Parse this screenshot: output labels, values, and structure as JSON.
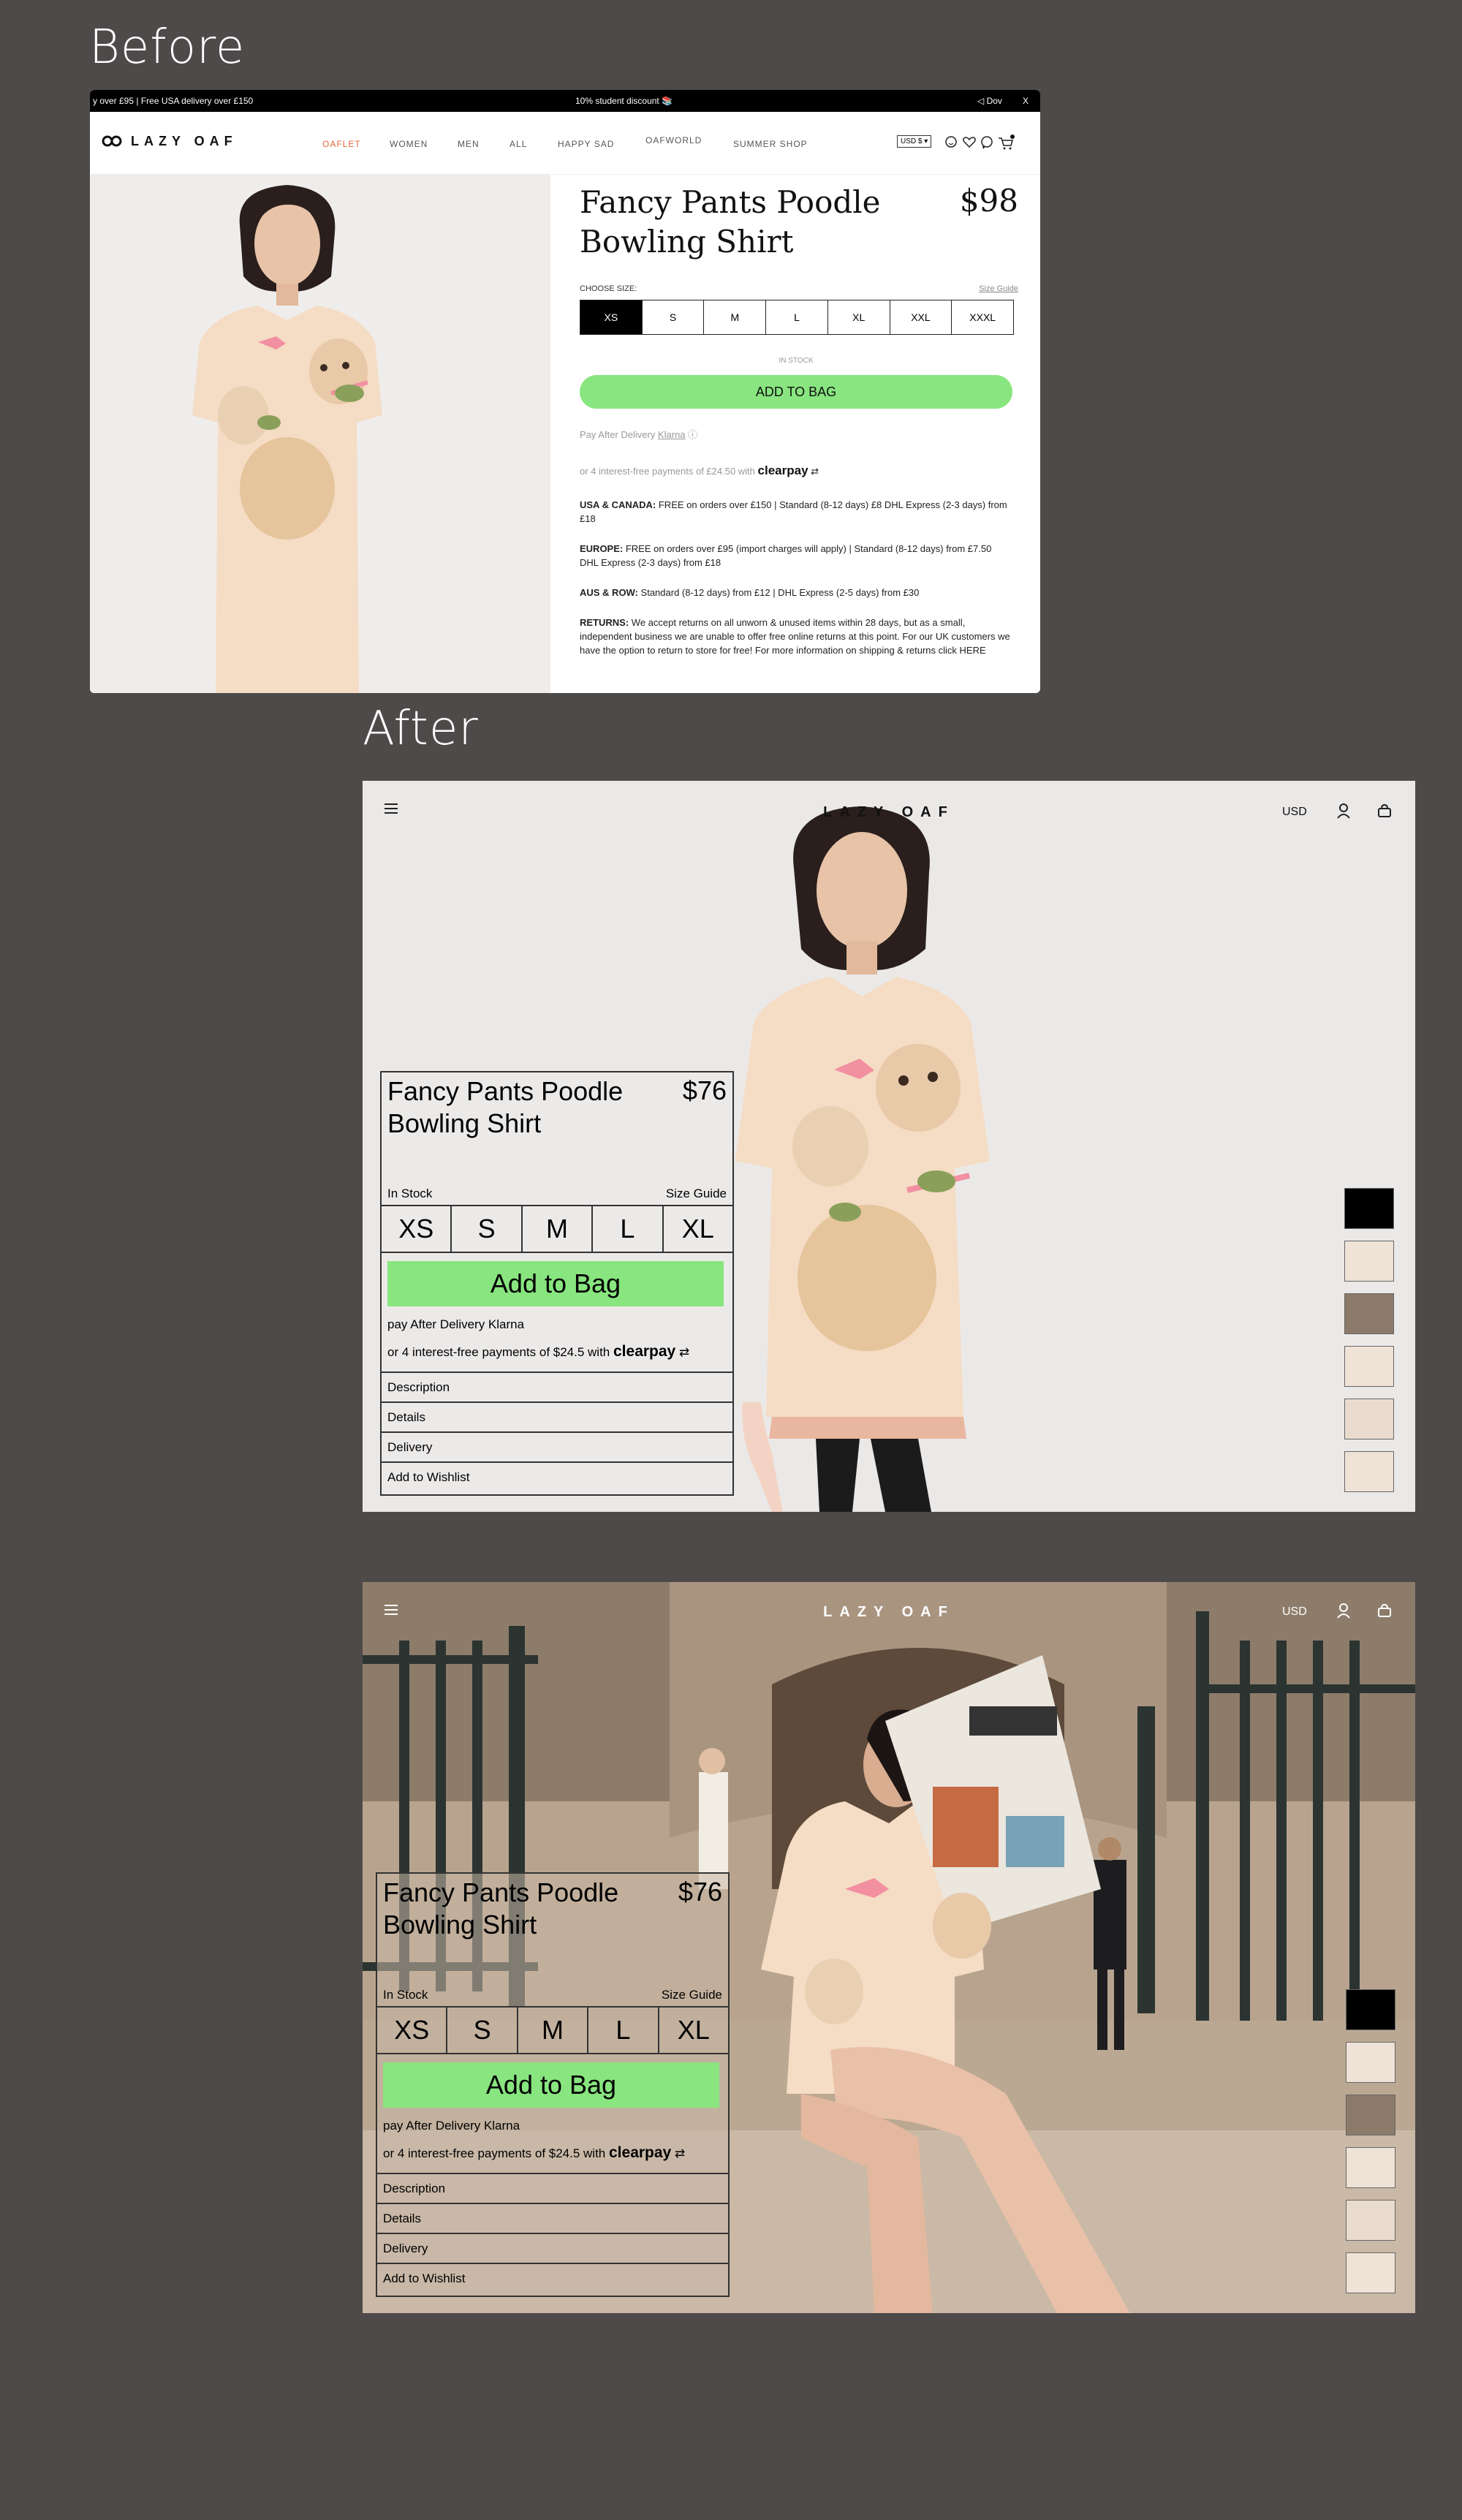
{
  "labels": {
    "before": "Before",
    "after": "After"
  },
  "before": {
    "promo": {
      "left": "y over £95 | Free USA delivery over £150",
      "center": "10% student discount 📚",
      "right": "◁ Dov",
      "close": "X"
    },
    "logo": "LAZY OAF",
    "nav": [
      "OAFLET",
      "WOMEN",
      "MEN",
      "ALL",
      "HAPPY SAD",
      "OAFWORLD",
      "SUMMER SHOP"
    ],
    "currency": "USD $ ▾",
    "product": {
      "title": "Fancy Pants Poodle Bowling Shirt",
      "price": "$98",
      "choose_size": "CHOOSE SIZE:",
      "size_guide": "Size Guide",
      "sizes": [
        "XS",
        "S",
        "M",
        "L",
        "XL",
        "XXL",
        "XXXL"
      ],
      "selected_size": "XS",
      "stock": "IN STOCK",
      "add_to_bag": "ADD TO BAG",
      "pay_after": "Pay After Delivery",
      "klarna": "Klarna",
      "installments": "or 4 interest-free payments of £24.50 with",
      "clearpay": "clearpay",
      "shipping": [
        {
          "label": "USA & CANADA:",
          "text": " FREE on orders over £150 | Standard (8-12 days) £8 DHL Express (2-3 days) from £18"
        },
        {
          "label": "EUROPE:",
          "text": " FREE on orders over £95 (import charges will apply) | Standard (8-12 days) from £7.50 DHL Express (2-3 days) from £18"
        },
        {
          "label": "AUS & ROW:",
          "text": " Standard (8-12 days) from £12 | DHL Express (2-5 days) from £30"
        },
        {
          "label": "RETURNS:",
          "text": " We accept returns on all unworn & unused items within 28 days, but as a small, independent business we are unable to offer free online returns at this point. For our UK customers we have the option to return to store for free! For more information on shipping & returns click HERE"
        }
      ]
    }
  },
  "after": {
    "logo": "LAZY OAF",
    "currency": "USD",
    "product": {
      "title": "Fancy Pants Poodle Bowling Shirt",
      "price": "$76",
      "stock": "In Stock",
      "size_guide": "Size Guide",
      "sizes": [
        "XS",
        "S",
        "M",
        "L",
        "XL"
      ],
      "add_to_bag": "Add to Bag",
      "pay_after": "pay After Delivery Klarna",
      "installments": "or 4 interest-free payments of $24.5 with",
      "clearpay": "clearpay",
      "accordion": [
        "Description",
        "Details",
        "Delivery",
        "Add to Wishlist"
      ]
    }
  },
  "colors": {
    "background": "#4d4a49",
    "accent_green": "#88e57f",
    "oaflet_orange": "#e0663a",
    "shirt_cream": "#f5dcc4"
  }
}
